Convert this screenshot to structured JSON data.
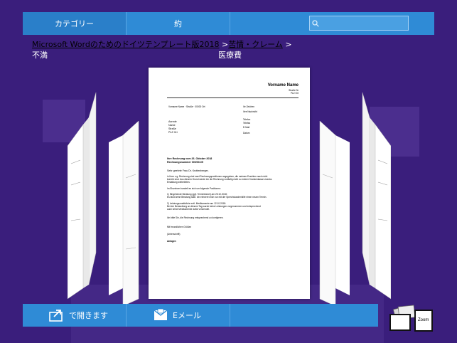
{
  "header": {
    "tabs": [
      {
        "label": "カテゴリー"
      },
      {
        "label": "約"
      }
    ],
    "search": {
      "value": "",
      "placeholder": ""
    }
  },
  "breadcrumb": {
    "item1": "Microsoft Wordのためのドイツテンプレート版2018",
    "sep1": ">",
    "item2": "苦情・クレーム",
    "sep2": ">",
    "item3": "不満",
    "item4": "医療費"
  },
  "document": {
    "sender_name": "Vorname Name",
    "sender_street": "Straße Nr",
    "sender_city": "PLZ Ort",
    "return_line": "Vorname Name · Straße · 00000 Ort",
    "ihr_zeichen": "Ihr Zeichen",
    "ihre_nachricht": "Ihre Nachricht",
    "telefon": "Telefon",
    "telefax": "Telefax",
    "email": "E-Mail",
    "datum": "Datum",
    "recipient": [
      "Anrede",
      "Name",
      "Straße",
      "PLZ Ort"
    ],
    "subject1": "Ihre Rechnung vom 26. Oktober 2018",
    "subject2": "Rechnungsnummer 000/00-05",
    "salutation": "Sehr geehrte Frau Dr. Krottenberger,",
    "body1": [
      "in Ihrer o.g. Rechnung sind zwei Rechnungspositionen angegeben, die meinem Erachten nach nicht",
      "korrekt sind. Aus diesem Grund werde ich die Rechnung vorläufig nicht zu meiner Krankenkasse zwecks",
      "Erstattung weiterleiten."
    ],
    "body2": "Im Einzelnen handelt es sich um folgende Positionen:",
    "item1": [
      "1)     Eingehende Beratung (ggf. Terminkürzel) am 25.10.2018:",
      "        Es fand keine Beratung statt. Ich erinnere mich nur mit der Sprechstundenhilfe einen neuen Termin."
    ],
    "item2": [
      "2)     Leistungszusätzliche evtl. Medikamente am 12.10.2018:",
      "        Bei der Behandlung an diesem Tag wurde keine Leistungen vorgenommen und entsprechend",
      "        auch keine Medikamente dafür verwendet."
    ],
    "request": "Ich bitte Sie, die Rechnung entsprechend zu korrigieren.",
    "closing": "Mit freundlichen Grüßen",
    "signature": "(Unterschrift)",
    "attachments": "Anlagen"
  },
  "footer": {
    "open_label": "で開きます",
    "mail_label": "Eメール",
    "zoom_label": "Zoom"
  },
  "colors": {
    "background": "#3a1e7c",
    "bar": "#2f8bd6"
  }
}
